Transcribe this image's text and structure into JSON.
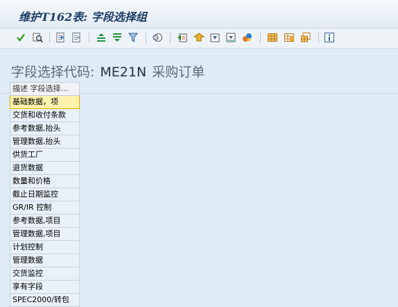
{
  "window": {
    "title": "维护T162表: 字段选择组"
  },
  "toolbar": {
    "icons": [
      "check-icon",
      "find-icon",
      "first-page-icon",
      "previous-page-icon",
      "align-left-icon",
      "filter-icon",
      "funnel-icon",
      "details-icon",
      "export-icon",
      "upload-icon",
      "download-icon",
      "print-icon",
      "view-icon",
      "grid-icon",
      "grid-add-icon",
      "layout-icon",
      "info-icon"
    ]
  },
  "heading": {
    "label": "字段选择代码:",
    "code": "ME21N",
    "description": "采购订单"
  },
  "table": {
    "header": "描述 字段选择...",
    "rows": [
      "基础数据，项",
      "交货和收付条款",
      "参考数据,抬头",
      "管理数据,抬头",
      "供货工厂",
      "退货数据",
      "数量和价格",
      "截止日期监控",
      "GR/IR 控制",
      "参考数据,项目",
      "管理数据,项目",
      "计划控制",
      "管理数据",
      "交货监控",
      "享有字段",
      "SPEC2000/转包"
    ],
    "selected_index": 0
  }
}
